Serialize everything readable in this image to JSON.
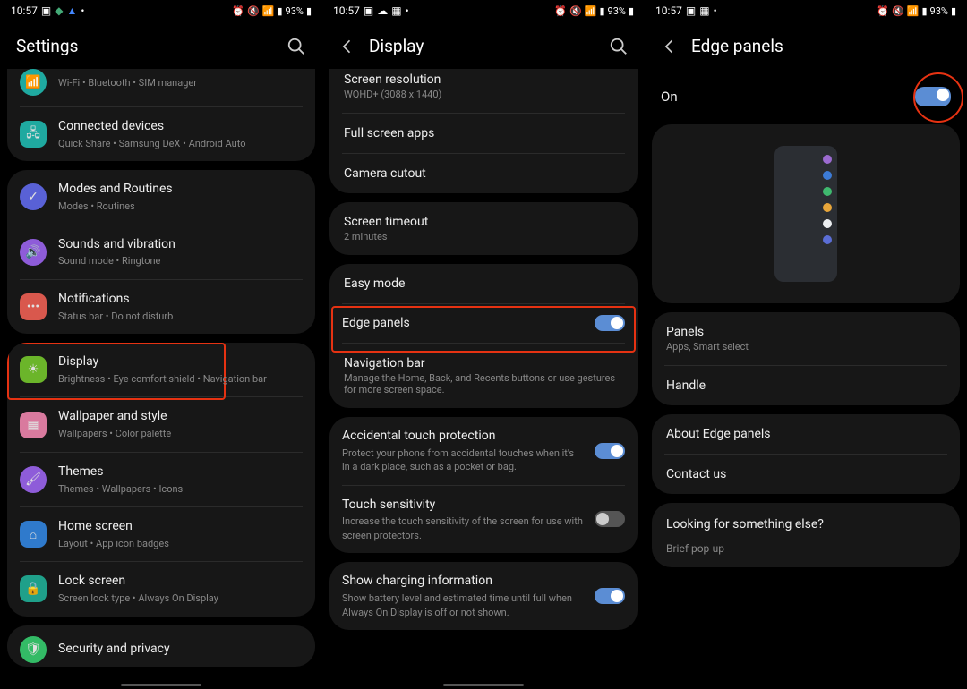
{
  "status_bar": {
    "time": "10:57",
    "battery": "93%"
  },
  "panel1": {
    "title": "Settings",
    "items": {
      "connections_sub": "Wi-Fi  •  Bluetooth  •  SIM manager",
      "connected_devices": "Connected devices",
      "connected_devices_sub": "Quick Share  •  Samsung DeX  •  Android Auto",
      "modes": "Modes and Routines",
      "modes_sub": "Modes  •  Routines",
      "sounds": "Sounds and vibration",
      "sounds_sub": "Sound mode  •  Ringtone",
      "notifications": "Notifications",
      "notifications_sub": "Status bar  •  Do not disturb",
      "display": "Display",
      "display_sub": "Brightness  •  Eye comfort shield  •  Navigation bar",
      "wallpaper": "Wallpaper and style",
      "wallpaper_sub": "Wallpapers  •  Color palette",
      "themes": "Themes",
      "themes_sub": "Themes  •  Wallpapers  •  Icons",
      "homescreen": "Home screen",
      "homescreen_sub": "Layout  •  App icon badges",
      "lockscreen": "Lock screen",
      "lockscreen_sub": "Screen lock type  •  Always On Display",
      "security": "Security and privacy"
    }
  },
  "panel2": {
    "title": "Display",
    "resolution_title": "Screen resolution",
    "resolution_sub": "WQHD+ (3088 x 1440)",
    "fullscreen": "Full screen apps",
    "cutout": "Camera cutout",
    "timeout": "Screen timeout",
    "timeout_sub": "2 minutes",
    "easy": "Easy mode",
    "edge": "Edge panels",
    "navbar": "Navigation bar",
    "navbar_sub": "Manage the Home, Back, and Recents buttons or use gestures for more screen space.",
    "atp": "Accidental touch protection",
    "atp_sub": "Protect your phone from accidental touches when it's in a dark place, such as a pocket or bag.",
    "tsens": "Touch sensitivity",
    "tsens_sub": "Increase the touch sensitivity of the screen for use with screen protectors.",
    "charge": "Show charging information",
    "charge_sub": "Show battery level and estimated time until full when Always On Display is off or not shown."
  },
  "panel3": {
    "title": "Edge panels",
    "on_label": "On",
    "panels": "Panels",
    "panels_sub": "Apps, Smart select",
    "handle": "Handle",
    "about": "About Edge panels",
    "contact": "Contact us",
    "looking": "Looking for something else?",
    "brief": "Brief pop-up",
    "preview_colors": [
      "#9c6bd1",
      "#3c7bd6",
      "#3fb96f",
      "#e8a63a",
      "#eceff1",
      "#5b6ed6"
    ]
  },
  "colors": {
    "conn": "#1fa9a0",
    "modes": "#5961d6",
    "sounds": "#8e5cd9",
    "notif": "#d9584d",
    "display": "#6bb52a",
    "wallpaper": "#d97a9e",
    "themes": "#8e5cd9",
    "home": "#2f7acc",
    "lock": "#1fa08a"
  }
}
